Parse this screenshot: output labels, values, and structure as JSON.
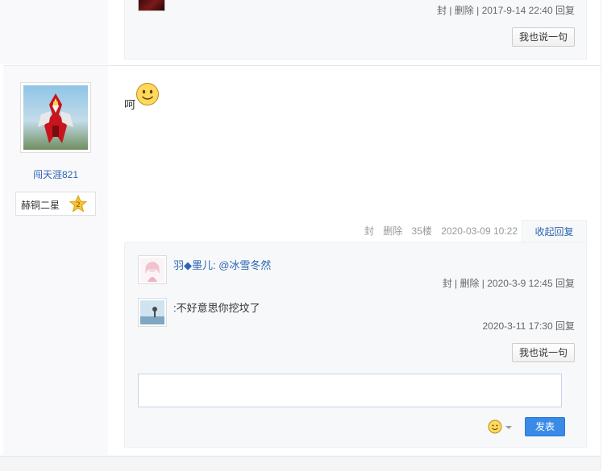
{
  "previous_floor": {
    "meta": "封 | 删除 | 2017-9-14 22:40  回复",
    "say_button": "我也说一句"
  },
  "post": {
    "username": "闯天涯821",
    "rank": "赫铜二星",
    "rank_level": "2",
    "content": "呵",
    "footer": {
      "seal": "封",
      "delete": "删除",
      "floor": "35楼",
      "time": "2020-03-09 10:22"
    },
    "collapse_label": "收起回复"
  },
  "replies": [
    {
      "author": "羽◆墨儿",
      "text": ": @冰雪冬然",
      "meta": "封 | 删除 | 2020-3-9 12:45  回复"
    },
    {
      "author": "",
      "text": ":不好意思你挖坟了",
      "meta": "2020-3-11 17:30  回复"
    }
  ],
  "reply_panel": {
    "say_button": "我也说一句",
    "input_value": "",
    "submit_label": "发表"
  },
  "colors": {
    "link": "#2d64b3",
    "submit": "#3a8be8",
    "panel_bg": "#f7f8fa"
  }
}
